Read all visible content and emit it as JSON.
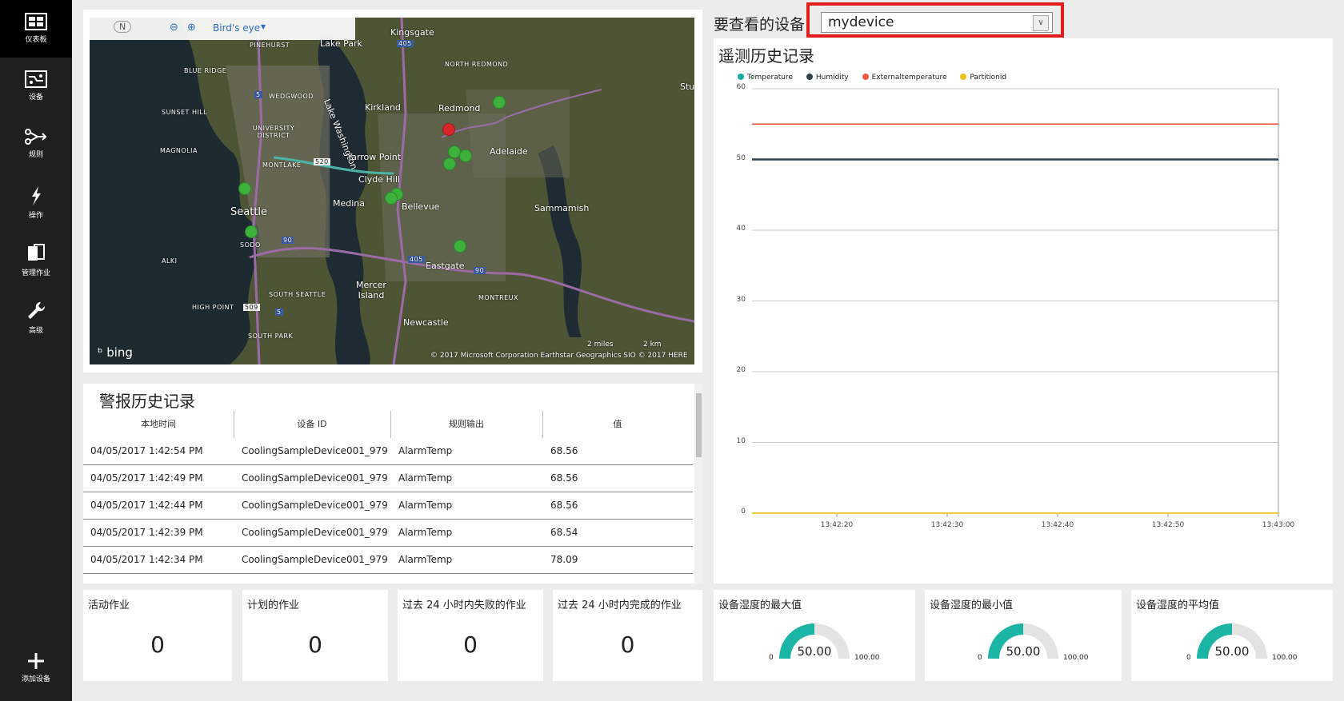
{
  "sidebar": {
    "items": [
      {
        "label": "仪表板",
        "icon": "dashboard-icon",
        "active": true
      },
      {
        "label": "设备",
        "icon": "devices-icon"
      },
      {
        "label": "规则",
        "icon": "rules-icon"
      },
      {
        "label": "操作",
        "icon": "actions-icon"
      },
      {
        "label": "管理作业",
        "icon": "jobs-icon"
      },
      {
        "label": "高级",
        "icon": "wrench-icon"
      }
    ],
    "add_device_label": "添加设备"
  },
  "map": {
    "compass": "N",
    "view_mode": "Bird's eye",
    "labels": {
      "kingsgate": "Kingsgate",
      "lake_park": "Lake Park",
      "pinehurst": "PINEHURST",
      "north_redmond": "NORTH REDMOND",
      "blue_ridge": "BLUE RIDGE",
      "wedgwood": "WEDGWOOD",
      "lake_washington": "Lake Washington",
      "kirkland": "Kirkland",
      "redmond": "Redmond",
      "sunset_hill": "SUNSET HILL",
      "university_district": "UNIVERSITY DISTRICT",
      "magnolia": "MAGNOLIA",
      "adelaide": "Adelaide",
      "yarrow_point": "Yarrow Point",
      "montlake": "MONTLAKE",
      "clyde_hill": "Clyde Hill",
      "medina": "Medina",
      "bellevue": "Bellevue",
      "sammamish": "Sammamish",
      "seattle": "Seattle",
      "sodo": "SODO",
      "alki": "ALKI",
      "eastgate": "Eastgate",
      "mercer_island": "Mercer Island",
      "montreux": "MONTREUX",
      "south_seattle": "SOUTH SEATTLE",
      "high_point": "HIGH POINT",
      "south_park": "SOUTH PARK",
      "newcastle": "Newcastle",
      "stu": "Stu",
      "shield_5": "5",
      "shield_520": "520",
      "shield_90a": "90",
      "shield_405a": "405",
      "shield_405b": "405",
      "shield_90b": "90",
      "shield_509": "509",
      "shield_5b": "5"
    },
    "bing": "bing",
    "copyright": "© 2017 Microsoft Corporation   Earthstar Geographics SIO   © 2017 HERE",
    "scale_miles": "2 miles",
    "scale_km": "2 km",
    "pin_colors": {
      "ok": "#3cb13c",
      "alarm": "#d9262a"
    }
  },
  "alarms": {
    "title": "警报历史记录",
    "columns": [
      "本地时间",
      "设备 ID",
      "规则输出",
      "值"
    ],
    "rows": [
      [
        "04/05/2017 1:42:54 PM",
        "CoolingSampleDevice001_979",
        "AlarmTemp",
        "68.56"
      ],
      [
        "04/05/2017 1:42:49 PM",
        "CoolingSampleDevice001_979",
        "AlarmTemp",
        "68.56"
      ],
      [
        "04/05/2017 1:42:44 PM",
        "CoolingSampleDevice001_979",
        "AlarmTemp",
        "68.56"
      ],
      [
        "04/05/2017 1:42:39 PM",
        "CoolingSampleDevice001_979",
        "AlarmTemp",
        "68.54"
      ],
      [
        "04/05/2017 1:42:34 PM",
        "CoolingSampleDevice001_979",
        "AlarmTemp",
        "78.09"
      ]
    ]
  },
  "device_selector": {
    "label": "要查看的设备",
    "value": "mydevice"
  },
  "telemetry": {
    "title": "遥测历史记录"
  },
  "chart_data": {
    "type": "line",
    "title": "",
    "xlabel": "",
    "ylabel": "",
    "x": [
      "13:42:20",
      "13:42:30",
      "13:42:40",
      "13:42:50",
      "13:43:00"
    ],
    "yticks": [
      0,
      10,
      20,
      30,
      40,
      50,
      60
    ],
    "ylim": [
      0,
      60
    ],
    "grid": true,
    "legend": "top-left",
    "series": [
      {
        "name": "Temperature",
        "color": "#1aaba0",
        "values": [
          50,
          50,
          50,
          50,
          50
        ]
      },
      {
        "name": "Humidity",
        "color": "#2d4450",
        "values": [
          50,
          50,
          50,
          50,
          50
        ]
      },
      {
        "name": "Externaltemperature",
        "color": "#f05a4a",
        "values": [
          55,
          55,
          55,
          55,
          55
        ]
      },
      {
        "name": "Partitionid",
        "color": "#e8c41a",
        "values": [
          0,
          0,
          0,
          0,
          0
        ]
      }
    ]
  },
  "tiles": {
    "active_jobs": {
      "title": "活动作业",
      "value": "0"
    },
    "scheduled_jobs": {
      "title": "计划的作业",
      "value": "0"
    },
    "failed_jobs": {
      "title": "过去 24 小时内失败的作业",
      "value": "0"
    },
    "completed_jobs": {
      "title": "过去 24 小时内完成的作业",
      "value": "0"
    }
  },
  "gauges": [
    {
      "title": "设备湿度的最大值",
      "value": "50.00",
      "min": "0",
      "max": "100.00",
      "fraction": 0.5
    },
    {
      "title": "设备湿度的最小值",
      "value": "50.00",
      "min": "0",
      "max": "100.00",
      "fraction": 0.5
    },
    {
      "title": "设备湿度的平均值",
      "value": "50.00",
      "min": "0",
      "max": "100.00",
      "fraction": 0.5
    }
  ],
  "colors": {
    "gauge_fill": "#1bb5a6",
    "gauge_track": "#e3e3e3",
    "highlight": "#e41c1c"
  }
}
